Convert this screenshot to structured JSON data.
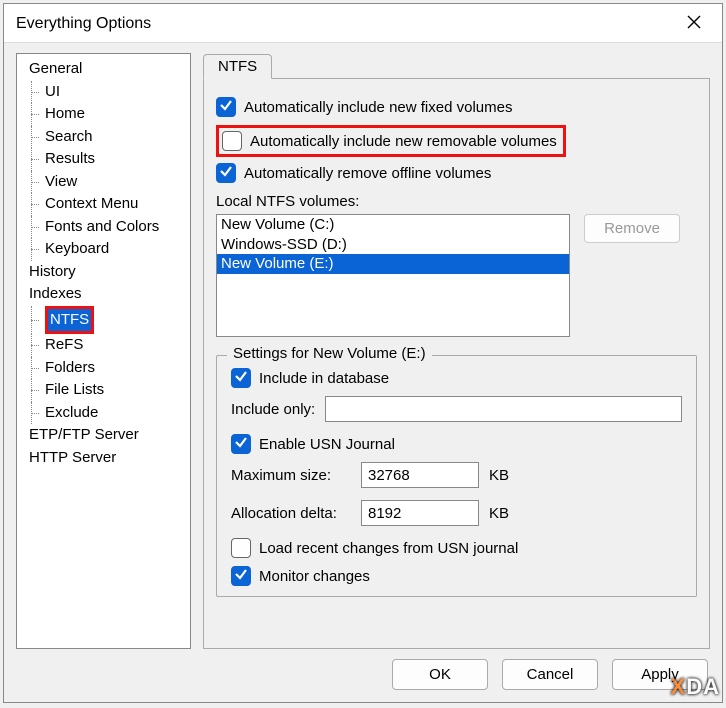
{
  "window": {
    "title": "Everything Options"
  },
  "tree": [
    {
      "label": "General",
      "level": 0
    },
    {
      "label": "UI",
      "level": 1
    },
    {
      "label": "Home",
      "level": 1
    },
    {
      "label": "Search",
      "level": 1
    },
    {
      "label": "Results",
      "level": 1
    },
    {
      "label": "View",
      "level": 1
    },
    {
      "label": "Context Menu",
      "level": 1
    },
    {
      "label": "Fonts and Colors",
      "level": 1
    },
    {
      "label": "Keyboard",
      "level": 1
    },
    {
      "label": "History",
      "level": 0
    },
    {
      "label": "Indexes",
      "level": 0
    },
    {
      "label": "NTFS",
      "level": 1,
      "selected": true,
      "highlighted": true
    },
    {
      "label": "ReFS",
      "level": 1
    },
    {
      "label": "Folders",
      "level": 1
    },
    {
      "label": "File Lists",
      "level": 1
    },
    {
      "label": "Exclude",
      "level": 1
    },
    {
      "label": "ETP/FTP Server",
      "level": 0
    },
    {
      "label": "HTTP Server",
      "level": 0
    }
  ],
  "tab": {
    "label": "NTFS"
  },
  "checkboxes": {
    "auto_fixed": {
      "label": "Automatically include new fixed volumes",
      "checked": true
    },
    "auto_removable": {
      "label": "Automatically include new removable volumes",
      "checked": false,
      "highlighted": true
    },
    "auto_offline": {
      "label": "Automatically remove offline volumes",
      "checked": true
    }
  },
  "volumes": {
    "label": "Local NTFS volumes:",
    "items": [
      {
        "label": "New Volume (C:)",
        "selected": false
      },
      {
        "label": "Windows-SSD (D:)",
        "selected": false
      },
      {
        "label": "New Volume (E:)",
        "selected": true
      }
    ],
    "remove_btn": "Remove"
  },
  "settings": {
    "legend": "Settings for New Volume (E:)",
    "include_db": {
      "label": "Include in database",
      "checked": true
    },
    "include_only": {
      "label": "Include only:",
      "value": ""
    },
    "enable_usn": {
      "label": "Enable USN Journal",
      "checked": true
    },
    "max_size": {
      "label": "Maximum size:",
      "value": "32768",
      "unit": "KB"
    },
    "alloc_delta": {
      "label": "Allocation delta:",
      "value": "8192",
      "unit": "KB"
    },
    "load_recent": {
      "label": "Load recent changes from USN journal",
      "checked": false
    },
    "monitor": {
      "label": "Monitor changes",
      "checked": true
    }
  },
  "footer": {
    "ok": "OK",
    "cancel": "Cancel",
    "apply": "Apply"
  },
  "watermark": "XDA"
}
